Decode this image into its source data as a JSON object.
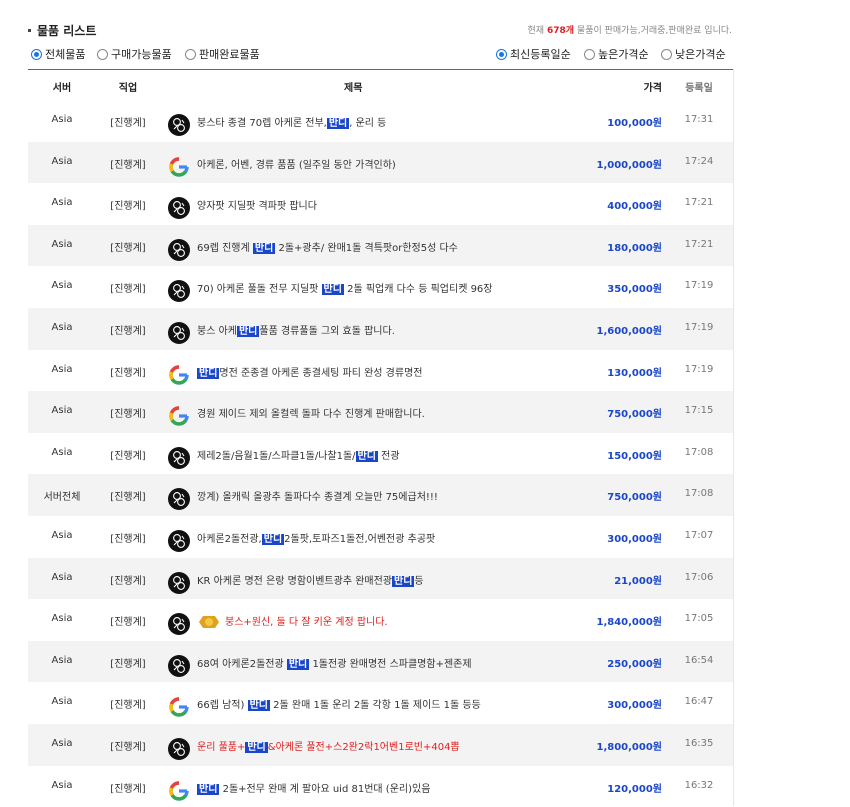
{
  "header": {
    "title": "물품 리스트",
    "notice_prefix": "현재",
    "notice_count": "678개",
    "notice_suffix": "물품이 판매가능,거래중,판매완료 입니다."
  },
  "filters": {
    "left": [
      "전체물품",
      "구매가능물품",
      "판매완료물품"
    ],
    "left_selected": 0,
    "right": [
      "최신등록일순",
      "높은가격순",
      "낮은가격순"
    ],
    "right_selected": 0
  },
  "columns": [
    "서버",
    "직업",
    "제목",
    "가격",
    "등록일"
  ],
  "rows": [
    {
      "server": "Asia",
      "job": "[진행계]",
      "icon": "hoyoverse-icon",
      "title_parts": [
        "붕스타 종결 70렙 아케론 전부,",
        "반디",
        ", 운리 등"
      ],
      "title_red": false,
      "price": "100,000원",
      "time": "17:31"
    },
    {
      "server": "Asia",
      "job": "[진행계]",
      "icon": "google-icon",
      "title_parts": [
        "아케론, 어벤, 경류 품품 (일주일 동안 가격인하)"
      ],
      "title_red": false,
      "price": "1,000,000원",
      "time": "17:24"
    },
    {
      "server": "Asia",
      "job": "[진행계]",
      "icon": "hoyoverse-icon",
      "title_parts": [
        "양자팟 지딜팟 격파팟 팝니다"
      ],
      "title_red": false,
      "price": "400,000원",
      "time": "17:21"
    },
    {
      "server": "Asia",
      "job": "[진행계]",
      "icon": "hoyoverse-icon",
      "title_parts": [
        "69렙 진행계 ",
        "반디",
        " 2돌+광추/ 완매1돌 격특팟or한정5성 다수"
      ],
      "title_red": false,
      "price": "180,000원",
      "time": "17:21"
    },
    {
      "server": "Asia",
      "job": "[진행계]",
      "icon": "hoyoverse-icon",
      "title_parts": [
        "70) 아케론 풀돌 전무 지딜팟 ",
        "반디",
        " 2돌 픽업캐 다수 등 픽업티켓 96장"
      ],
      "title_red": false,
      "price": "350,000원",
      "time": "17:19"
    },
    {
      "server": "Asia",
      "job": "[진행계]",
      "icon": "hoyoverse-icon",
      "title_parts": [
        "붕스 아케",
        "반디",
        "풀품 경류풀돌 그외 효돌 팝니다."
      ],
      "title_red": false,
      "price": "1,600,000원",
      "time": "17:19"
    },
    {
      "server": "Asia",
      "job": "[진행계]",
      "icon": "google-icon",
      "title_parts": [
        "",
        "반디",
        "명전 준종결 아케론 종결세팅 파티 완성 경류명전"
      ],
      "title_red": false,
      "price": "130,000원",
      "time": "17:19"
    },
    {
      "server": "Asia",
      "job": "[진행계]",
      "icon": "google-icon",
      "title_parts": [
        "경원 제이드 제외 올컬렉 돌파 다수 진행계 판매합니다."
      ],
      "title_red": false,
      "price": "750,000원",
      "time": "17:15"
    },
    {
      "server": "Asia",
      "job": "[진행계]",
      "icon": "hoyoverse-icon",
      "title_parts": [
        "제레2돌/음월1돌/스파클1돌/나찰1돌/",
        "반디",
        " 전광"
      ],
      "title_red": false,
      "price": "150,000원",
      "time": "17:08"
    },
    {
      "server": "서버전체",
      "job": "[진행계]",
      "icon": "hoyoverse-icon",
      "title_parts": [
        "깡계) 올캐릭 올광추 돌파다수 종결계 오늘만 75에급처!!!"
      ],
      "title_red": false,
      "price": "750,000원",
      "time": "17:08"
    },
    {
      "server": "Asia",
      "job": "[진행계]",
      "icon": "hoyoverse-icon",
      "title_parts": [
        "아케론2돌전광,",
        "반디",
        "2돌팟,토파즈1돌전,어벤전광 추공팟"
      ],
      "title_red": false,
      "price": "300,000원",
      "time": "17:07"
    },
    {
      "server": "Asia",
      "job": "[진행계]",
      "icon": "hoyoverse-icon",
      "title_parts": [
        "KR 아케론 명전 은랑 명함이벤트광추 완매전광",
        "반디",
        "등"
      ],
      "title_red": false,
      "price": "21,000원",
      "time": "17:06"
    },
    {
      "server": "Asia",
      "job": "[진행계]",
      "icon": "hoyoverse-icon",
      "title_parts": [
        "붕스+원신, 둘 다 잘 키운 계정 팝니다."
      ],
      "title_red": true,
      "badge": "gold-badge-icon",
      "price": "1,840,000원",
      "time": "17:05"
    },
    {
      "server": "Asia",
      "job": "[진행계]",
      "icon": "hoyoverse-icon",
      "title_parts": [
        "68여 아케론2돌전광 ",
        "반디",
        " 1돌전광 완매명전 스파클명함+젠존제"
      ],
      "title_red": false,
      "price": "250,000원",
      "time": "16:54"
    },
    {
      "server": "Asia",
      "job": "[진행계]",
      "icon": "google-icon",
      "title_parts": [
        "66렙 남적) ",
        "반디",
        " 2돌 완매 1돌 운리 2돌 각항 1돌 제이드 1돌 등등"
      ],
      "title_red": false,
      "price": "300,000원",
      "time": "16:47"
    },
    {
      "server": "Asia",
      "job": "[진행계]",
      "icon": "hoyoverse-icon",
      "title_parts": [
        "운리 풀품+",
        "반디",
        "&아케론 풀전+스2완2락1어벤1로빈+404뽑"
      ],
      "title_red": true,
      "price": "1,800,000원",
      "time": "16:35"
    },
    {
      "server": "Asia",
      "job": "[진행계]",
      "icon": "google-icon",
      "title_parts": [
        "",
        "반디",
        " 2돌+전무 완매 계 팔아요 uid 81번대 (운리)있음"
      ],
      "title_red": false,
      "price": "120,000원",
      "time": "16:32"
    }
  ]
}
